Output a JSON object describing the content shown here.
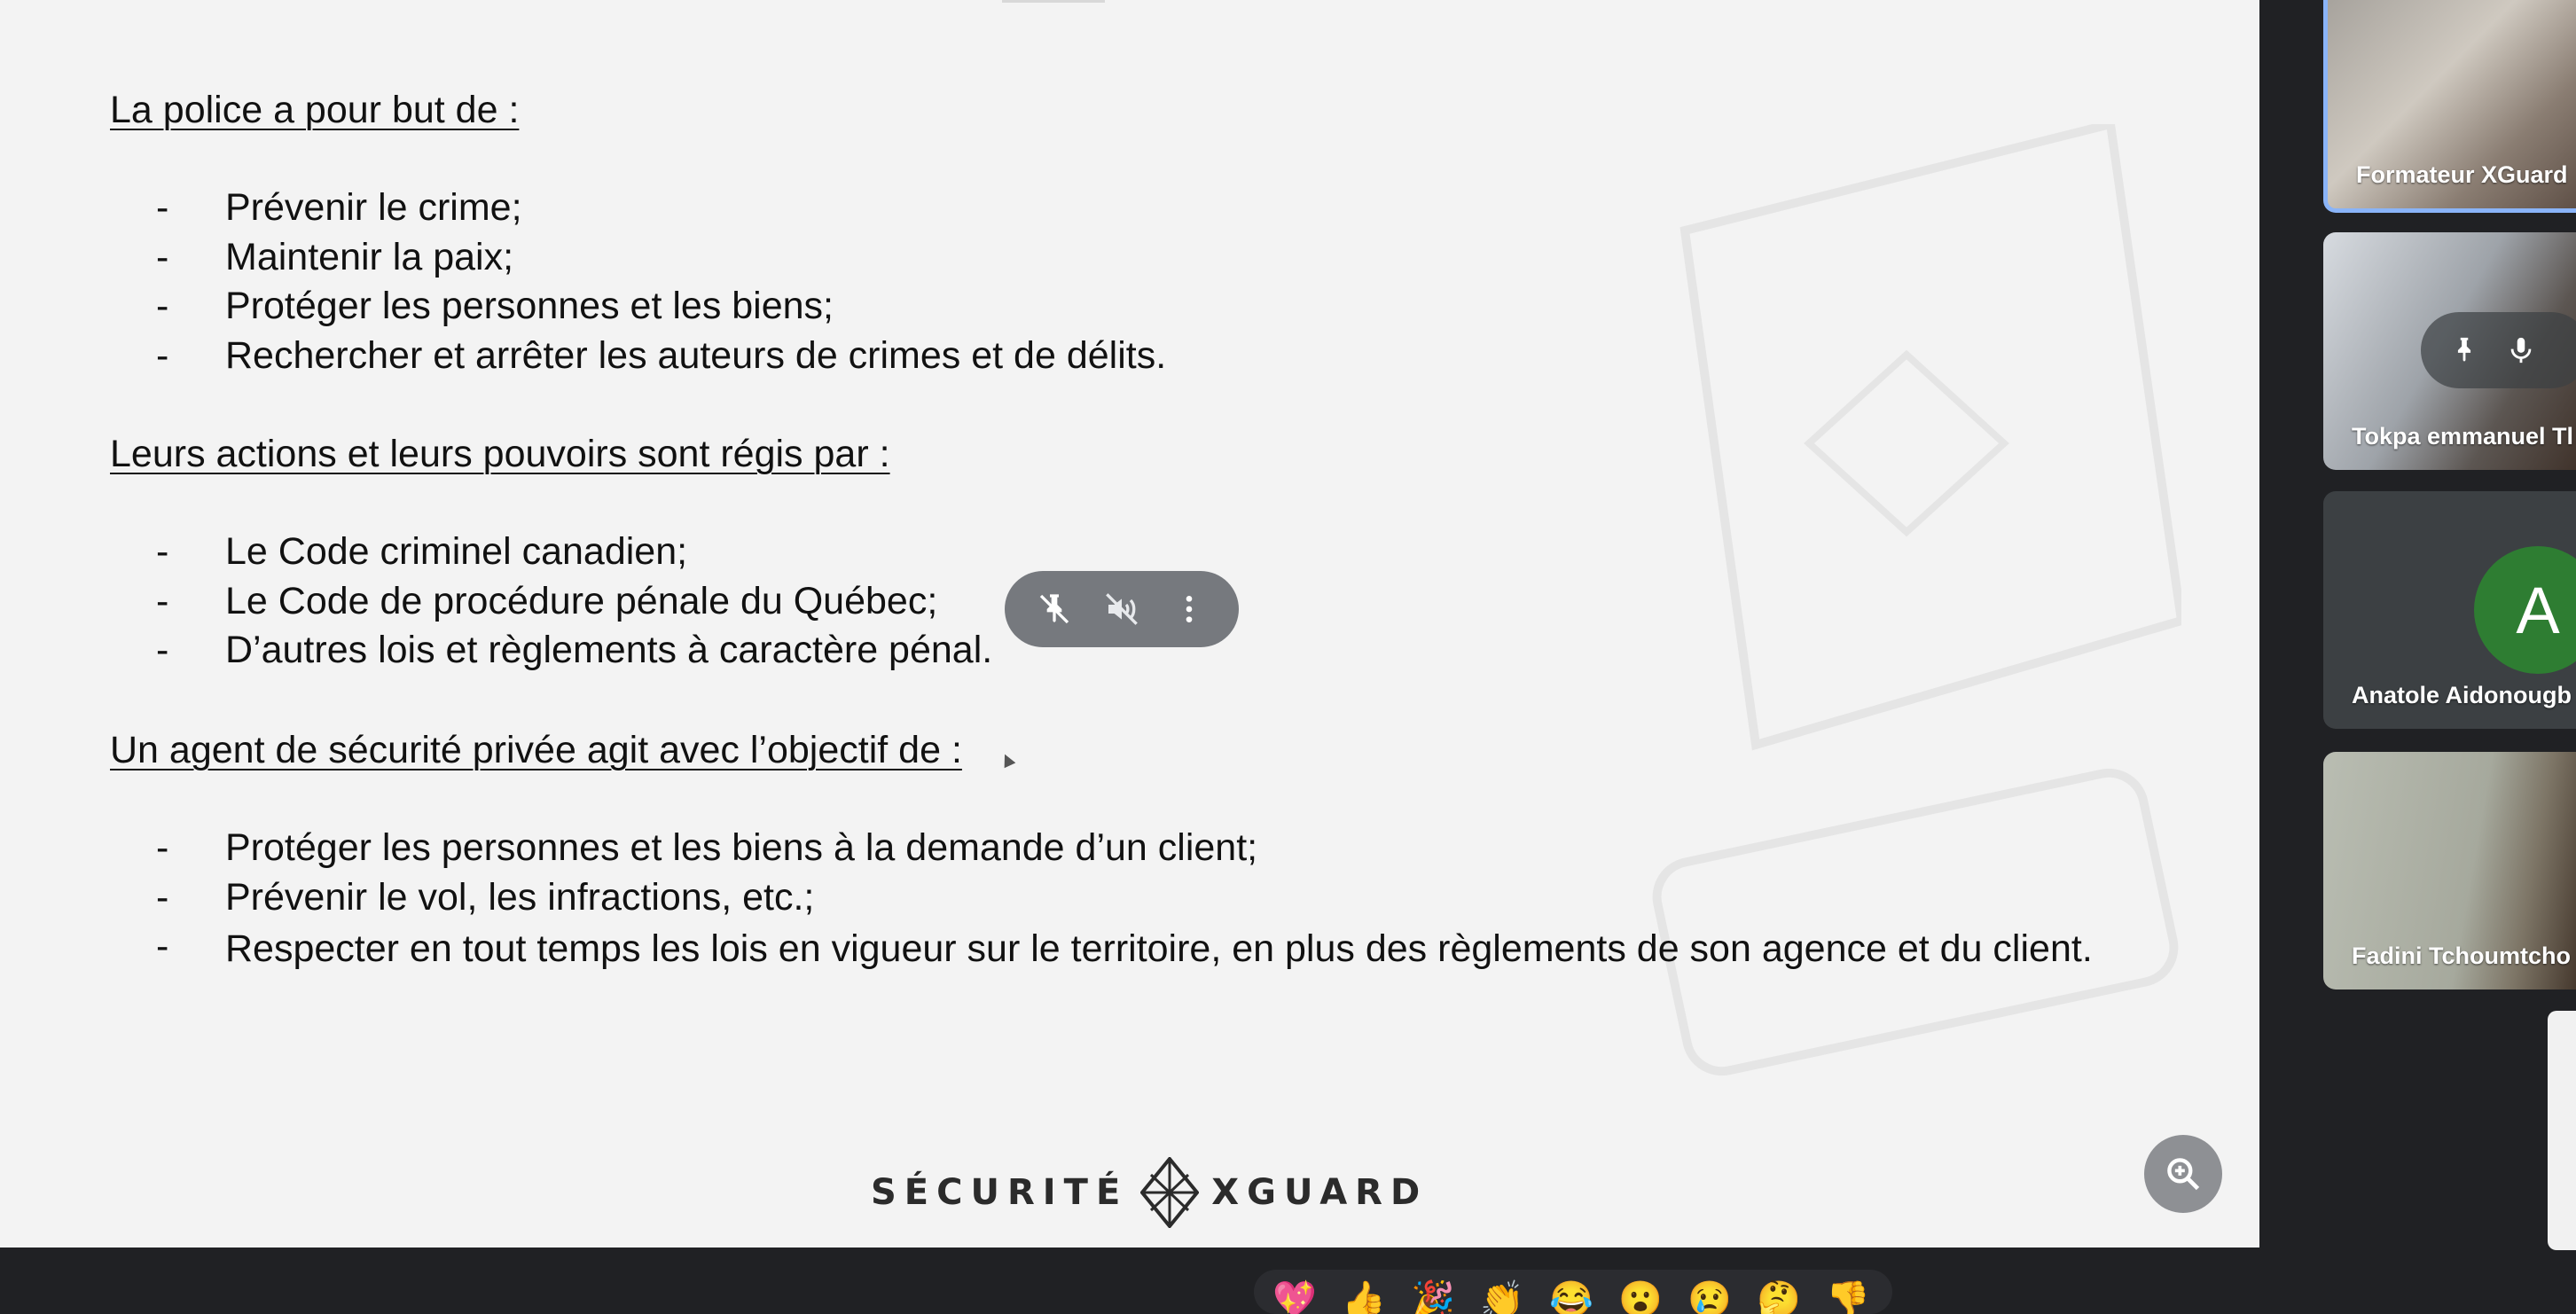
{
  "slide": {
    "sections": [
      {
        "heading": "La police a pour but de :",
        "bullets": [
          "Prévenir le crime;",
          "Maintenir la paix;",
          "Protéger les personnes et les biens;",
          "Rechercher et arrêter les auteurs de crimes et de délits."
        ]
      },
      {
        "heading": "Leurs actions et leurs pouvoirs sont régis par :",
        "bullets": [
          "Le Code criminel canadien;",
          "Le Code de procédure pénale du Québec;",
          "D’autres lois et règlements à caractère pénal."
        ]
      },
      {
        "heading": "Un agent de sécurité privée agit avec l’objectif de :",
        "bullets": [
          "Protéger les personnes et les biens à la demande d’un client;",
          "Prévenir le vol, les infractions, etc.;",
          "Respecter en tout temps les lois en vigueur sur le territoire, en plus des règlements de son agence et du client."
        ]
      }
    ],
    "bullet_marker": "-",
    "logo": {
      "left": "SÉCURITÉ",
      "right": "XGUARD"
    }
  },
  "presenter_controls": {
    "icons": [
      "unpin-icon",
      "mute-off-icon",
      "more-options-icon"
    ]
  },
  "zoom_button": {
    "icon": "zoom-in-icon"
  },
  "participants": [
    {
      "name": "Formateur XGuard",
      "active_speaker": true
    },
    {
      "name": "Tokpa emmanuel Tl"
    },
    {
      "name": "Anatole Aidonougb",
      "avatar_letter": "A",
      "avatar_color": "#2e7d32"
    },
    {
      "name": "Fadini Tchoumtcho"
    }
  ],
  "reactions": [
    "💖",
    "👍",
    "🎉",
    "👏",
    "😂",
    "😮",
    "😢",
    "🤔",
    "👎"
  ],
  "colors": {
    "slide_bg": "#f3f3f3",
    "app_bg": "#202124",
    "active_border": "#8ab4f8"
  }
}
